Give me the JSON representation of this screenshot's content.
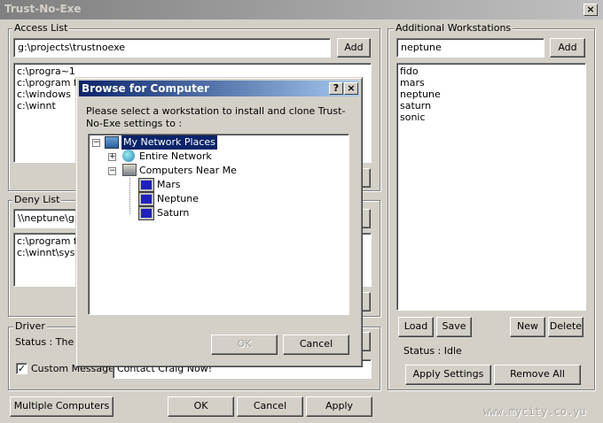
{
  "window": {
    "title": "Trust-No-Exe",
    "close": "×"
  },
  "access_list": {
    "label": "Access List",
    "input_value": "g:\\projects\\trustnoexe",
    "add": "Add",
    "items": [
      "c:\\progra~1",
      "c:\\program files",
      "c:\\windows",
      "c:\\winnt"
    ]
  },
  "deny_list": {
    "label": "Deny List",
    "input_value": "\\\\neptune\\g$",
    "items": [
      "c:\\program files",
      "c:\\winnt\\system32"
    ]
  },
  "driver": {
    "label": "Driver",
    "status": "Status : The s",
    "custom_message_label": "Custom Message",
    "custom_message_checked": true,
    "custom_message_value": "Contact Craig Now!"
  },
  "bottom": {
    "multiple": "Multiple Computers",
    "ok": "OK",
    "cancel": "Cancel",
    "apply": "Apply"
  },
  "workstations": {
    "label": "Additional Workstations",
    "input_value": "neptune",
    "add": "Add",
    "items": [
      "fido",
      "mars",
      "neptune",
      "saturn",
      "sonic"
    ],
    "load": "Load",
    "save": "Save",
    "new": "New",
    "delete": "Delete",
    "status": "Status : Idle",
    "apply_settings": "Apply Settings",
    "remove_all": "Remove All"
  },
  "watermark": "www.mycity.co.yu",
  "dialog": {
    "title": "Browse for Computer",
    "help": "?",
    "close": "×",
    "prompt": "Please select a workstation to install and clone Trust-No-Exe settings to :",
    "ok": "OK",
    "cancel": "Cancel",
    "tree": {
      "root": "My Network Places",
      "entire": "Entire Network",
      "near": "Computers Near Me",
      "computers": [
        "Mars",
        "Neptune",
        "Saturn"
      ]
    }
  },
  "colors": {
    "dialog_title": "#0a246a",
    "selection": "#0a246a"
  }
}
